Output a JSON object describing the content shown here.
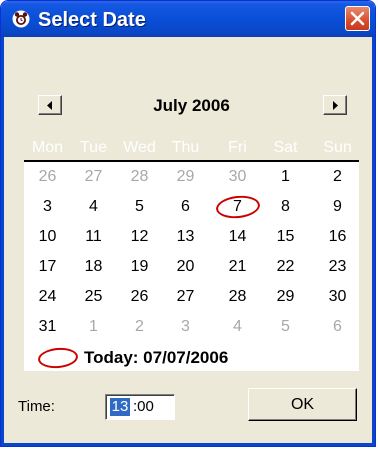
{
  "window": {
    "title": "Select Date"
  },
  "icons": {
    "app": "alarm-clock-icon",
    "close": "close-icon",
    "prev": "left-arrow-icon",
    "next": "right-arrow-icon"
  },
  "calendar": {
    "month_label": "July 2006",
    "weekdays": [
      "Mon",
      "Tue",
      "Wed",
      "Thu",
      "Fri",
      "Sat",
      "Sun"
    ],
    "weeks": [
      [
        {
          "d": "26",
          "other": true
        },
        {
          "d": "27",
          "other": true
        },
        {
          "d": "28",
          "other": true
        },
        {
          "d": "29",
          "other": true
        },
        {
          "d": "30",
          "other": true
        },
        {
          "d": "1"
        },
        {
          "d": "2"
        }
      ],
      [
        {
          "d": "3"
        },
        {
          "d": "4"
        },
        {
          "d": "5"
        },
        {
          "d": "6"
        },
        {
          "d": "7",
          "today": true
        },
        {
          "d": "8"
        },
        {
          "d": "9"
        }
      ],
      [
        {
          "d": "10"
        },
        {
          "d": "11"
        },
        {
          "d": "12"
        },
        {
          "d": "13"
        },
        {
          "d": "14"
        },
        {
          "d": "15"
        },
        {
          "d": "16"
        }
      ],
      [
        {
          "d": "17"
        },
        {
          "d": "18"
        },
        {
          "d": "19"
        },
        {
          "d": "20"
        },
        {
          "d": "21"
        },
        {
          "d": "22"
        },
        {
          "d": "23"
        }
      ],
      [
        {
          "d": "24"
        },
        {
          "d": "25"
        },
        {
          "d": "26"
        },
        {
          "d": "27"
        },
        {
          "d": "28"
        },
        {
          "d": "29"
        },
        {
          "d": "30"
        }
      ],
      [
        {
          "d": "31"
        },
        {
          "d": "1",
          "other": true
        },
        {
          "d": "2",
          "other": true
        },
        {
          "d": "3",
          "other": true
        },
        {
          "d": "4",
          "other": true
        },
        {
          "d": "5",
          "other": true
        },
        {
          "d": "6",
          "other": true
        }
      ]
    ],
    "today_text": "Today: 07/07/2006"
  },
  "time": {
    "label": "Time:",
    "hour": "13",
    "minute": ":00"
  },
  "ok_label": "OK",
  "colors": {
    "titlebar": "#0a4fd8",
    "today_ring": "#cc0000",
    "hour_highlight": "#316ac5",
    "face": "#ece9d8"
  }
}
